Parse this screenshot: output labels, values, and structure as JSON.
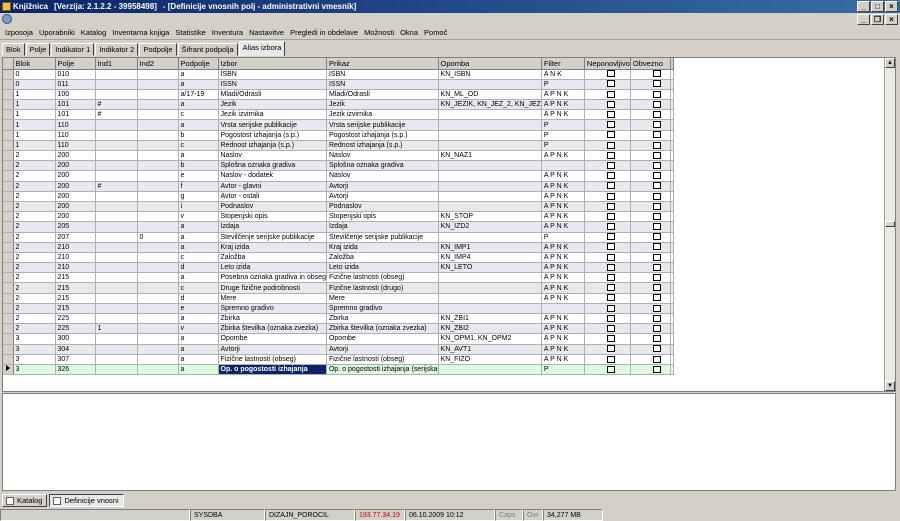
{
  "window": {
    "app_name": "Knjižnica",
    "version": "[Verzija: 2.1.2.2 - 39958498]",
    "doc_title": "- [Definicije vnosnih polj - administrativni vmesnik]"
  },
  "menu": [
    "Izposoja",
    "Uporabniki",
    "Katalog",
    "Inventarna knjiga",
    "Statistike",
    "Inventura",
    "Nastavitve",
    "Pregledi in obdelave",
    "Možnosti",
    "Okna",
    "Pomoč"
  ],
  "tabs": [
    "Blok",
    "Polje",
    "Indikator 1",
    "Indikator 2",
    "Podpolje",
    "Šifrant podpolja",
    "Alias izbora"
  ],
  "active_tab": "Alias izbora",
  "columns": [
    "Blok",
    "Polje",
    "Ind1",
    "Ind2",
    "Podpolje",
    "Izbor",
    "Prikaz",
    "Opomba",
    "Filter",
    "Neponovljivo",
    "Obvezno"
  ],
  "rows": [
    [
      "0",
      "010",
      "",
      "",
      "a",
      "ISBN",
      "ISBN",
      "KN_ISBN",
      "A N K"
    ],
    [
      "0",
      "011",
      "",
      "",
      "a",
      "ISSN",
      "ISSN",
      "",
      "P"
    ],
    [
      "1",
      "100",
      "",
      "",
      "a/17-19",
      "Mladi/Odrasli",
      "Mladi/Odrasli",
      "KN_ML_OD",
      "A P N K"
    ],
    [
      "1",
      "101",
      "#",
      "",
      "a",
      "Jezik",
      "Jezik",
      "KN_JEZIK, KN_JEZ_2, KN_JEZ",
      "A P N K"
    ],
    [
      "1",
      "101",
      "#",
      "",
      "c",
      "Jezik izvirnika",
      "Jezik izvirnika",
      "",
      "A P N K"
    ],
    [
      "1",
      "110",
      "",
      "",
      "a",
      "Vrsta serijske publikacije",
      "Vrsta serijske publikacije",
      "",
      "P"
    ],
    [
      "1",
      "110",
      "",
      "",
      "b",
      "Pogostost izhajanja (s.p.)",
      "Pogostost izhajanja (s.p.)",
      "",
      "P"
    ],
    [
      "1",
      "110",
      "",
      "",
      "c",
      "Rednost izhajanja (s.p.)",
      "Rednost izhajanja (s.p.)",
      "",
      "P"
    ],
    [
      "2",
      "200",
      "",
      "",
      "a",
      "Naslov",
      "Naslov",
      "KN_NAZ1",
      "A P N K"
    ],
    [
      "2",
      "200",
      "",
      "",
      "b",
      "Splošna oznaka gradiva",
      "Splošna oznaka gradiva",
      "",
      ""
    ],
    [
      "2",
      "200",
      "",
      "",
      "e",
      "Naslov - dodatek",
      "Naslov",
      "",
      "A P N K"
    ],
    [
      "2",
      "200",
      "#",
      "",
      "f",
      "Avtor - glavni",
      "Avtorji",
      "",
      "A P N K"
    ],
    [
      "2",
      "200",
      "",
      "",
      "g",
      "Avtor - ostali",
      "Avtorji",
      "",
      "A P N K"
    ],
    [
      "2",
      "200",
      "",
      "",
      "i",
      "Podnaslov",
      "Podnaslov",
      "",
      "A P N K"
    ],
    [
      "2",
      "200",
      "",
      "",
      "v",
      "Stopenjski opis",
      "Stopenjski opis",
      "KN_STOP",
      "A P N K"
    ],
    [
      "2",
      "205",
      "",
      "",
      "a",
      "Izdaja",
      "Izdaja",
      "KN_IZD2",
      "A P N K"
    ],
    [
      "2",
      "207",
      "",
      "0",
      "a",
      "Številčenje serijske publikacije",
      "Številčenje serijske publikacije",
      "",
      "P"
    ],
    [
      "2",
      "210",
      "",
      "",
      "a",
      "Kraj izida",
      "Kraj izida",
      "KN_IMP1",
      "A P N K"
    ],
    [
      "2",
      "210",
      "",
      "",
      "c",
      "Založba",
      "Založba",
      "KN_IMP4",
      "A P N K"
    ],
    [
      "2",
      "210",
      "",
      "",
      "d",
      "Leto izida",
      "Leto izida",
      "KN_LETO",
      "A P N K"
    ],
    [
      "2",
      "215",
      "",
      "",
      "a",
      "Posebna oznaka gradiva in obseg",
      "Fizične lastnosti (obseg)",
      "",
      "A P N K"
    ],
    [
      "2",
      "215",
      "",
      "",
      "c",
      "Druge fizične podrobnosti",
      "Fizične lastnosti (drugo)",
      "",
      "A P N K"
    ],
    [
      "2",
      "215",
      "",
      "",
      "d",
      "Mere",
      "Mere",
      "",
      "A P N K"
    ],
    [
      "2",
      "215",
      "",
      "",
      "e",
      "Spremno gradivo",
      "Spremno gradivo",
      "",
      ""
    ],
    [
      "2",
      "225",
      "",
      "",
      "a",
      "Zbirka",
      "Zbirka",
      "KN_ZBI1",
      "A P N K"
    ],
    [
      "2",
      "225",
      "1",
      "",
      "v",
      "Zbirka številka (oznaka zvezka)",
      "Zbirka številka (oznaka zvezka)",
      "KN_ZBI2",
      "A P N K"
    ],
    [
      "3",
      "300",
      "",
      "",
      "a",
      "Opombe",
      "Opombe",
      "KN_OPM1, KN_OPM2",
      "A P N K"
    ],
    [
      "3",
      "304",
      "",
      "",
      "a",
      "Avtorji",
      "Avtorji",
      "KN_AVT1",
      "A P N K"
    ],
    [
      "3",
      "307",
      "",
      "",
      "a",
      "Fizične lastnosti (obseg)",
      "Fizične lastnosti (obseg)",
      "KN_FIZO",
      "A P N K"
    ],
    [
      "3",
      "326",
      "",
      "",
      "a",
      "Op. o pogostosti izhajanja",
      "Op. o pogostosti izhajanja (serijska",
      "",
      "P"
    ]
  ],
  "taskbar": [
    "Katalog",
    "Definicije vnosni"
  ],
  "status": [
    "",
    "SYSDBA",
    "DIZAJN_POROCIL",
    "193.77.34.19",
    "06.10.2009 10:12",
    "Caps",
    "Ovr",
    "34,277 MB"
  ],
  "colors": {
    "title_start": "#0a246a",
    "title_end": "#3a6ea5",
    "row_alt": "#e6eaf0",
    "row_selected": "#ddfadd",
    "status_ip": "#c00000"
  }
}
